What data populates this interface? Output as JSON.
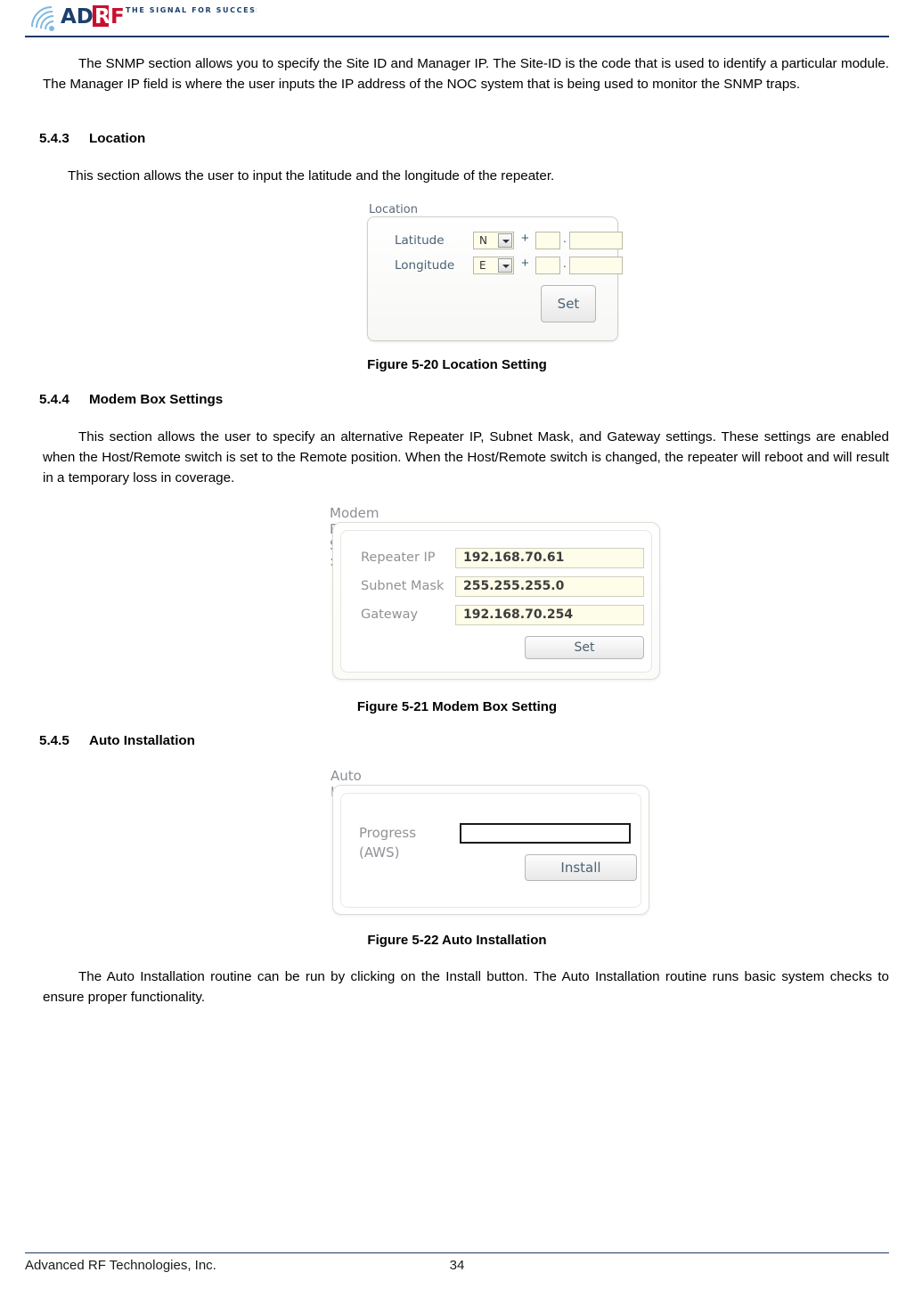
{
  "header": {
    "logo_text": "ADRF",
    "logo_tagline": "THE SIGNAL FOR SUCCESS"
  },
  "body": {
    "intro_paragraph": "The SNMP section allows you to specify the Site ID and Manager IP.  The Site-ID is the code that is used to identify a particular module.  The Manager IP field is where the user inputs the IP address of the NOC system that is being used to monitor the SNMP traps.",
    "section_location": {
      "number": "5.4.3",
      "title": "Location"
    },
    "location_paragraph": "This section allows the user to input the latitude and the longitude of the repeater.",
    "figure_5_20": "Figure 5-20   Location Setting",
    "section_modem": {
      "number": "5.4.4",
      "title": "Modem Box Settings"
    },
    "modem_paragraph": "This section allows the user to specify an alternative Repeater IP, Subnet Mask, and Gateway settings.  These settings are enabled when the Host/Remote switch is set to the Remote position.  When the Host/Remote switch is changed, the repeater will reboot and will result in a temporary loss in coverage.",
    "figure_5_21": "Figure 5-21   Modem Box Setting",
    "section_auto": {
      "number": "5.4.5",
      "title": "Auto Installation"
    },
    "figure_5_22": "Figure 5-22   Auto Installation",
    "auto_paragraph": "The Auto Installation routine can be run by clicking on the Install button.  The Auto Installation routine runs basic system checks to ensure proper functionality."
  },
  "location_panel": {
    "legend": "Location",
    "latitude_label": "Latitude",
    "latitude_hemisphere": "N",
    "longitude_label": "Longitude",
    "longitude_hemisphere": "E",
    "plus": "+",
    "decimal": ".",
    "latitude_degrees": "",
    "latitude_minutes": "",
    "longitude_degrees": "",
    "longitude_minutes": "",
    "set_button": "Set"
  },
  "modem_panel": {
    "title": "Modem Box Settings :",
    "rows": [
      {
        "label": "Repeater IP",
        "value": "192.168.70.61"
      },
      {
        "label": "Subnet Mask",
        "value": "255.255.255.0"
      },
      {
        "label": "Gateway",
        "value": "192.168.70.254"
      }
    ],
    "set_button": "Set"
  },
  "auto_panel": {
    "title": "Auto Installation",
    "progress_label_line1": "Progress",
    "progress_label_line2": "(AWS)",
    "progress_value": "",
    "install_button": "Install"
  },
  "footer": {
    "company": "Advanced RF Technologies, Inc.",
    "page_number": "34"
  }
}
